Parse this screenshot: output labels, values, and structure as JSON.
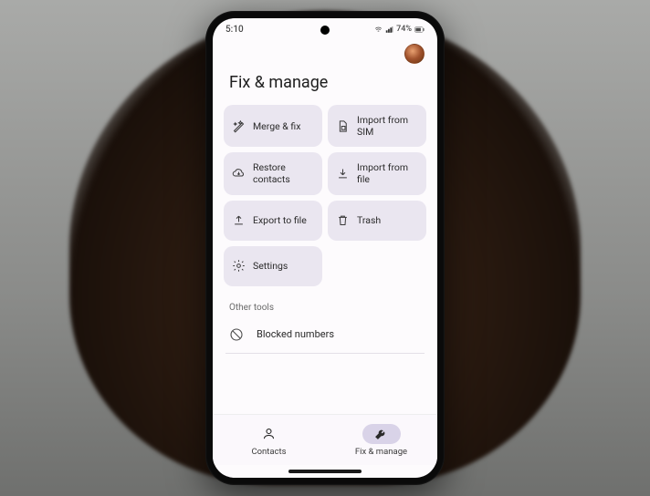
{
  "status": {
    "time": "5:10",
    "battery": "74%"
  },
  "title": "Fix & manage",
  "cards": {
    "merge": "Merge & fix",
    "sim": "Import from SIM",
    "restore": "Restore contacts",
    "file_import": "Import from file",
    "export": "Export to file",
    "trash": "Trash",
    "settings": "Settings"
  },
  "other_tools_label": "Other tools",
  "blocked": "Blocked numbers",
  "nav": {
    "contacts": "Contacts",
    "fix": "Fix & manage"
  }
}
